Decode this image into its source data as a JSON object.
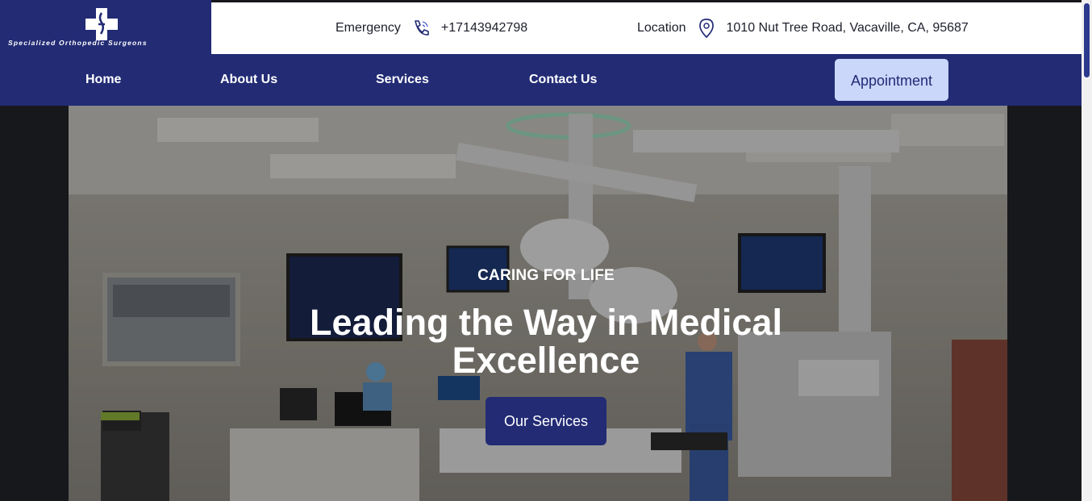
{
  "logo": {
    "name": "Specialized Orthopedic Surgeons"
  },
  "topbar": {
    "emergency_label": "Emergency",
    "phone": "+17143942798",
    "location_label": "Location",
    "address": "1010 Nut Tree Road, Vacaville, CA, 95687"
  },
  "nav": {
    "items": [
      "Home",
      "About Us",
      "Services",
      "Contact Us"
    ],
    "appointment_label": "Appointment"
  },
  "hero": {
    "kicker": "CARING FOR LIFE",
    "headline_line1": "Leading the Way in Medical",
    "headline_line2": "Excellence",
    "cta_label": "Our Services"
  },
  "colors": {
    "brand_navy": "#222b74",
    "accent_light": "#cbd6fb"
  },
  "icons": {
    "phone": "phone-icon",
    "location": "location-pin-icon",
    "logo": "medical-cross-icon"
  }
}
